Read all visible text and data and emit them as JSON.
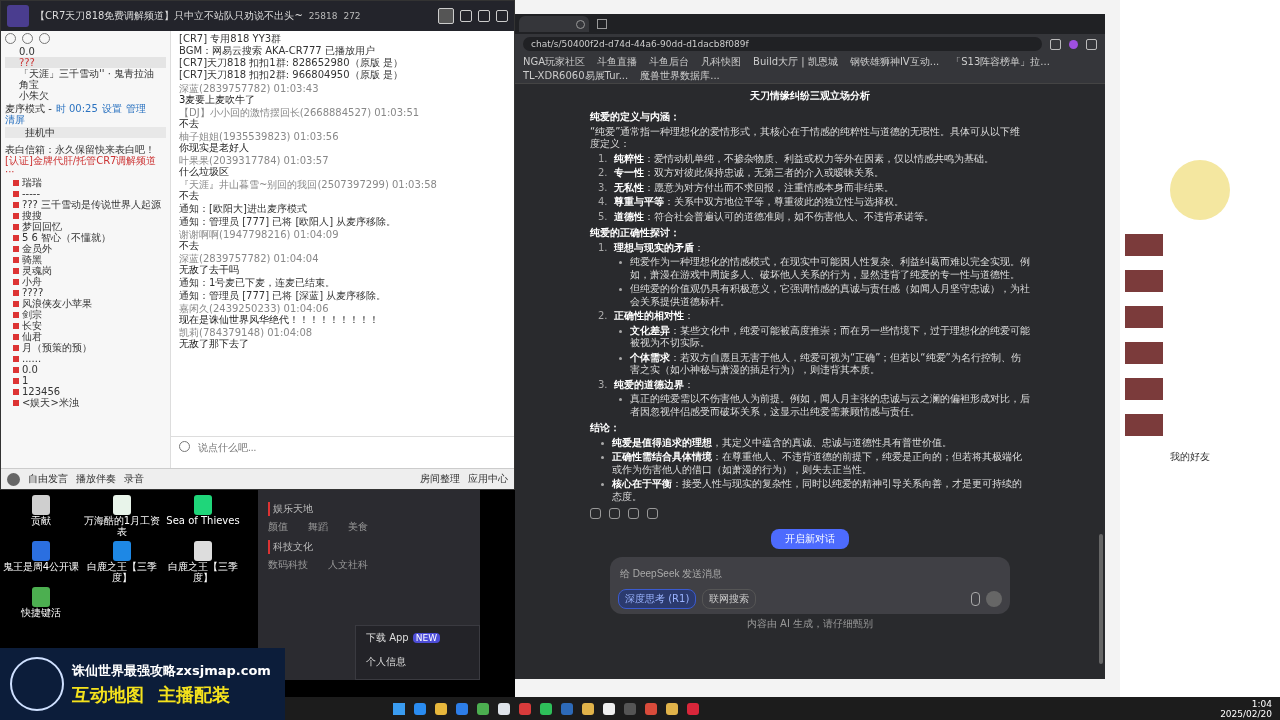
{
  "yy": {
    "title": "【CR7天刀818免费调解频道】只中立不站队只劝说不出头~",
    "online": "25818",
    "members": "272",
    "top_users": [
      {
        "name": "0.0",
        "selected": false
      },
      {
        "name": "???",
        "selected": true
      },
      {
        "name": "「天涯」三千雪动'' · 鬼青拉油",
        "selected": false
      },
      {
        "name": "角宝",
        "selected": false
      },
      {
        "name": "小朱欠",
        "selected": false
      }
    ],
    "mode": {
      "label": "麦序模式 -",
      "timer": "时 00:25",
      "actions": [
        "设置",
        "管理",
        "清屏"
      ]
    },
    "queue": [
      "挂机中"
    ],
    "channel_notice": "表白信箱：永久保留快来表白吧！",
    "channel": "[认证]金牌代肝/托管CR7调解频道 ···",
    "users": [
      "瑞瑞",
      "-----",
      "??? 三千雪动是传说世界人起源",
      "搜搜",
      "梦回回忆",
      "5 6 智心（不懂就）",
      "金员外",
      "骑黑",
      "灵魂岗",
      "小舟",
      "????",
      "风浪侠友小苹果",
      "剑宗",
      "长安",
      "仙君",
      "月（预策的预）",
      "......",
      "0.0",
      "1",
      "123456",
      "<娱天>米浊"
    ],
    "messages": [
      {
        "kind": "pinned",
        "text": "[CR7] 专用818 YY3群"
      },
      {
        "kind": "pinned",
        "text": "BGM：网易云搜索 AKA-CR777 已播放用户"
      },
      {
        "kind": "pinned",
        "text": "[CR7]天刀818 扣扣1群: 828652980（原版 是）"
      },
      {
        "kind": "pinned",
        "text": "[CR7]天刀818 扣扣2群: 966804950（原版 是）"
      },
      {
        "kind": "message",
        "meta": "深蓝(2839757782) 01:03:43",
        "text": "3麦要上麦吹牛了"
      },
      {
        "kind": "message",
        "meta": "【DJ】小小回的激情摆回长(2668884527) 01:03:51",
        "text": "不去"
      },
      {
        "kind": "message",
        "meta": "柚子姐姐(1935539823) 01:03:56",
        "text": "你现实是老好人"
      },
      {
        "kind": "message",
        "meta": "叶果果(2039317784) 01:03:57",
        "text": "什么垃圾区"
      },
      {
        "kind": "message",
        "meta": "『天涯』井山暮雪~别回的我回(2507397299) 01:03:58",
        "text": "不去"
      },
      {
        "kind": "notice",
        "text": "通知：[欧阳大]进出麦序模式"
      },
      {
        "kind": "notice",
        "text": "通知：管理员 [777] 已将 [欧阳人] 从麦序移除。"
      },
      {
        "kind": "message",
        "meta": "谢谢啊啊(1947798216) 01:04:09",
        "text": "不去"
      },
      {
        "kind": "message",
        "meta": "深蓝(2839757782) 01:04:04",
        "text": "无敌了去干吗"
      },
      {
        "kind": "notice",
        "text": "通知：1号麦已下麦，连麦已结束。"
      },
      {
        "kind": "notice",
        "text": "通知：管理员 [777] 已将 [深蓝] 从麦序移除。"
      },
      {
        "kind": "message",
        "meta": "嘉闲久(2439250233) 01:04:06",
        "text": "现在是诛仙世界风华绝代！！！！！！！！！"
      },
      {
        "kind": "message",
        "meta": "凯莉(784379148) 01:04:08",
        "text": "无敌了那下去了"
      }
    ],
    "input": {
      "placeholder": "说点什么吧..."
    },
    "bottom_buttons": [
      "自由发言",
      "播放伴奏",
      "录音"
    ],
    "bottom_right": [
      "房间整理",
      "应用中心"
    ]
  },
  "browser": {
    "address": "chat/s/50400f2d-d74d-44a6-90dd-d1dacb8f089f",
    "bookmarks": [
      "NGA玩家社区",
      "斗鱼直播",
      "斗鱼后台",
      "凡科快图",
      "Build大厅 | 凯恩城",
      "钢铁雄狮神IV互动...",
      "「S13阵容榜单」拉...",
      "TL-XDR6060易展Tur...",
      "魔兽世界数据库..."
    ],
    "chat_title": "天刀情缘纠纷三观立场分析",
    "sections": [
      {
        "heading": "纯爱的定义与内涵：",
        "intro": "“纯爱”通常指一种理想化的爱情形式，其核心在于情感的纯粹性与道德的无瑕性。具体可从以下维度定义：",
        "items": [
          {
            "number": "1.",
            "text": "**纯粹性**：爱情动机单纯，不掺杂物质、利益或权力等外在因素，仅以情感共鸣为基础。"
          },
          {
            "number": "2.",
            "text": "**专一性**：双方对彼此保持忠诚，无第三者的介入或暧昧关系。"
          },
          {
            "number": "3.",
            "text": "**无私性**：愿意为对方付出而不求回报，注重情感本身而非结果。"
          },
          {
            "number": "4.",
            "text": "**尊重与平等**：关系中双方地位平等，尊重彼此的独立性与选择权。"
          },
          {
            "number": "5.",
            "text": "**道德性**：符合社会普遍认可的道德准则，如不伤害他人、不违背承诺等。"
          }
        ]
      },
      {
        "heading": "纯爱的正确性探讨：",
        "items": [
          {
            "number": "1.",
            "text": "**理想与现实的矛盾**：",
            "children": [
              "纯爱作为一种理想化的情感模式，在现实中可能因人性复杂、利益纠葛而难以完全实现。例如，萧漫在游戏中周旋多人、破坏他人关系的行为，显然违背了纯爱的专一性与道德性。",
              "但纯爱的价值观仍具有积极意义，它强调情感的真诚与责任感（如闻人月坚守忠诚），为社会关系提供道德标杆。"
            ]
          },
          {
            "number": "2.",
            "text": "**正确性的相对性**：",
            "children": [
              "**文化差异**：某些文化中，纯爱可能被高度推崇；而在另一些情境下，过于理想化的纯爱可能被视为不切实际。",
              "**个体需求**：若双方自愿且无害于他人，纯爱可视为“正确”；但若以“纯爱”为名行控制、伤害之实（如小神秘与萧漫的插足行为），则违背其本质。"
            ]
          },
          {
            "number": "3.",
            "text": "**纯爱的道德边界**：",
            "children": [
              "真正的纯爱需以不伤害他人为前提。例如，闻人月主张的忠诚与云之澜的偏袒形成对比，后者因忽视伴侣感受而破坏关系，这显示出纯爱需兼顾情感与责任。"
            ]
          }
        ]
      },
      {
        "heading": "结论：",
        "items": [
          {
            "text": "**纯爱是值得追求的理想**，其定义中蕴含的真诚、忠诚与道德性具有普世价值。"
          },
          {
            "text": "**正确性需结合具体情境**：在尊重他人、不违背道德的前提下，纯爱是正向的；但若将其极端化或作为伤害他人的借口（如萧漫的行为），则失去正当性。"
          },
          {
            "text": "**核心在于平衡**：接受人性与现实的复杂性，同时以纯爱的精神引导关系向善，才是更可持续的态度。"
          }
        ]
      }
    ],
    "new_chat": "开启新对话",
    "composer": {
      "placeholder": "给 DeepSeek 发送消息",
      "deep_think": {
        "label": "深度思考 (R1)",
        "on": true
      },
      "web_search": {
        "label": "联网搜索",
        "on": false
      }
    },
    "footer": "内容由 AI 生成，请仔细甄别"
  },
  "menu": {
    "categories": [
      {
        "title": "娱乐天地",
        "items": [
          "颜值",
          "舞蹈",
          "美食"
        ]
      },
      {
        "title": "科技文化",
        "items": [
          "数码科技",
          "人文社科"
        ]
      }
    ],
    "popup": [
      {
        "label": "下载 App",
        "badge": "NEW"
      },
      {
        "label": "个人信息"
      }
    ]
  },
  "desktop_icons": [
    {
      "label": "贡献",
      "kind": "image"
    },
    {
      "label": "万海酷的1月工资表",
      "kind": "sheet"
    },
    {
      "label": "Sea of Thieves",
      "kind": "game"
    },
    {
      "label": "鬼王是周4公开课",
      "kind": "doc"
    },
    {
      "label": "白鹿之王【三季度】",
      "kind": "zip"
    },
    {
      "label": "白鹿之王【三季度】",
      "kind": "poster"
    },
    {
      "label": "快捷键活",
      "kind": "app"
    }
  ],
  "banner": {
    "line1": "诛仙世界最强攻略zxsjmap.com",
    "line2a": "互动地图",
    "line2b": "主播配装"
  },
  "right_panel": {
    "friends_label": "我的好友"
  },
  "clock": {
    "time": "1:04",
    "date": "2025/02/20"
  }
}
